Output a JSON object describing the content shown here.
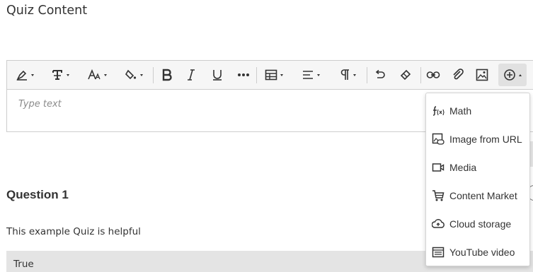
{
  "page": {
    "section_title": "Quiz Content"
  },
  "editor": {
    "placeholder": "Type text",
    "toolbar": [
      {
        "name": "text-style",
        "icon": "pen-style-icon",
        "has_menu": true
      },
      {
        "name": "paragraph-style",
        "icon": "text-format-icon",
        "has_menu": true
      },
      {
        "name": "font-size",
        "icon": "font-size-icon",
        "has_menu": true
      },
      {
        "name": "highlight-color",
        "icon": "paint-bucket-icon",
        "has_menu": true
      },
      {
        "name": "bold",
        "icon": "bold-icon",
        "has_menu": false
      },
      {
        "name": "italic",
        "icon": "italic-icon",
        "has_menu": false
      },
      {
        "name": "underline",
        "icon": "underline-icon",
        "has_menu": false
      },
      {
        "name": "more",
        "icon": "more-icon",
        "has_menu": false
      },
      {
        "name": "table",
        "icon": "table-icon",
        "has_menu": true
      },
      {
        "name": "align",
        "icon": "align-left-icon",
        "has_menu": true
      },
      {
        "name": "paragraph",
        "icon": "pilcrow-icon",
        "has_menu": true
      },
      {
        "name": "undo",
        "icon": "undo-icon",
        "has_menu": false
      },
      {
        "name": "clear-format",
        "icon": "eraser-icon",
        "has_menu": false
      },
      {
        "name": "link",
        "icon": "link-icon",
        "has_menu": false
      },
      {
        "name": "attach",
        "icon": "paperclip-icon",
        "has_menu": false
      },
      {
        "name": "image",
        "icon": "image-icon",
        "has_menu": false
      },
      {
        "name": "insert-content",
        "icon": "plus-circle-icon",
        "has_menu": true,
        "active": true
      }
    ]
  },
  "insert_menu": {
    "items": [
      {
        "label": "Math",
        "icon": "math-function-icon"
      },
      {
        "label": "Image from URL",
        "icon": "image-link-icon"
      },
      {
        "label": "Media",
        "icon": "video-camera-icon"
      },
      {
        "label": "Content Market",
        "icon": "cart-icon"
      },
      {
        "label": "Cloud storage",
        "icon": "cloud-upload-icon"
      },
      {
        "label": "YouTube video",
        "icon": "youtube-frame-icon"
      }
    ]
  },
  "question": {
    "title": "Question 1",
    "text": "This example Quiz is helpful",
    "answers": [
      "True"
    ]
  }
}
